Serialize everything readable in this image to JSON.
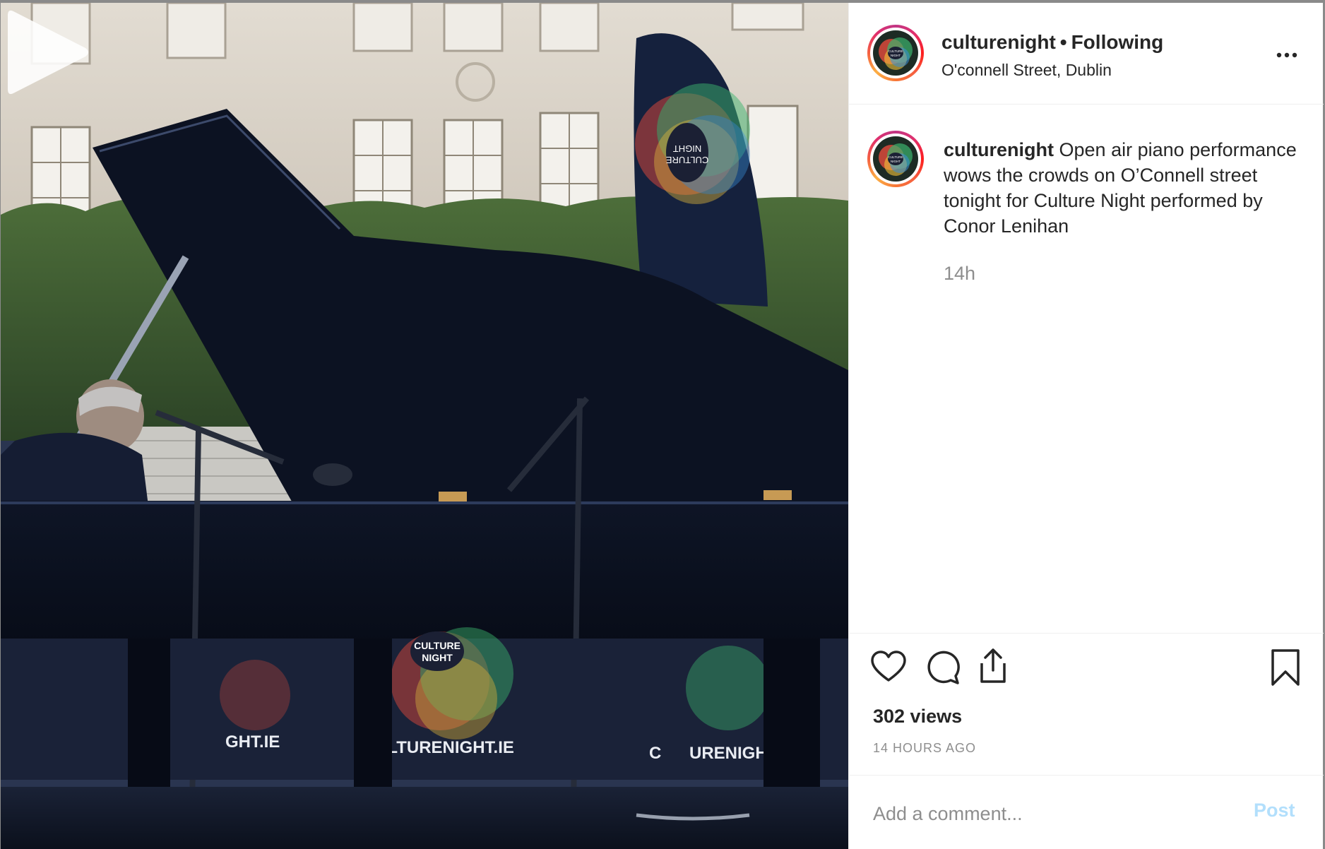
{
  "post": {
    "username": "culturenight",
    "separator": "•",
    "follow_status": "Following",
    "location": "O'connell Street, Dublin",
    "more_label": "...",
    "caption_user": "culturenight",
    "caption_text": "Open air piano performance wows the crowds on O’Connell street tonight for Culture Night performed by Conor Lenihan",
    "caption_time": "14h",
    "views": "302 views",
    "time_ago": "14 HOURS AGO"
  },
  "comment": {
    "placeholder": "Add a comment...",
    "post_label": "Post"
  },
  "media": {
    "banner_small_text_1": "CULTURE",
    "banner_small_text_2": "NIGHT",
    "banner_text_left": "GHT.IE",
    "banner_text_center": "ULTURENIGHT.IE",
    "banner_text_right_1": "C",
    "banner_text_right_2": "URENIGHT.II",
    "flag_text_1": "CULTURE",
    "flag_text_2": "NIGHT",
    "avatar_text_1": "CULTURE",
    "avatar_text_2": "NIGHT"
  },
  "icons": {
    "play": "play-icon",
    "more": "more-icon",
    "like": "heart-icon",
    "comment": "comment-icon",
    "share": "share-icon",
    "save": "bookmark-icon"
  },
  "colors": {
    "text": "#262626",
    "muted": "#8e8e8e",
    "post_disabled": "#b2dffc",
    "divider": "#efefef"
  }
}
